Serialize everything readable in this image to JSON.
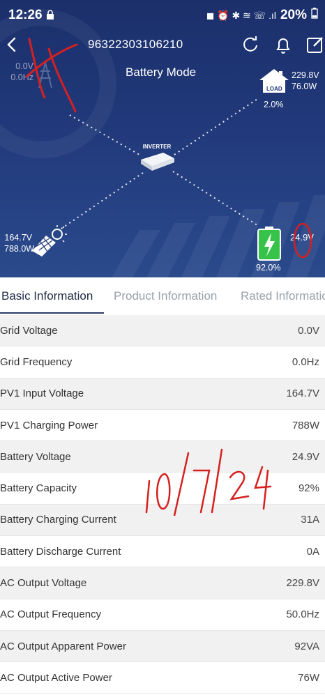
{
  "status_bar": {
    "time": "12:26",
    "battery_percent": "20%"
  },
  "header": {
    "device_id": "96322303106210",
    "mode": "Battery Mode"
  },
  "diagram": {
    "grid": {
      "voltage": "0.0V",
      "frequency": "0.0Hz"
    },
    "load": {
      "voltage": "229.8V",
      "power": "76.0W",
      "percent": "2.0%",
      "label": "LOAD"
    },
    "inverter": {
      "label": "INVERTER"
    },
    "pv": {
      "voltage": "164.7V",
      "power": "788.0W"
    },
    "battery": {
      "voltage": "24.9V",
      "percent": "92.0%"
    }
  },
  "tabs": [
    {
      "label": "Basic Information",
      "active": true
    },
    {
      "label": "Product Information",
      "active": false
    },
    {
      "label": "Rated Information",
      "active": false
    }
  ],
  "rows": [
    {
      "label": "Grid Voltage",
      "value": "0.0V"
    },
    {
      "label": "Grid Frequency",
      "value": "0.0Hz"
    },
    {
      "label": "PV1 Input Voltage",
      "value": "164.7V"
    },
    {
      "label": "PV1 Charging Power",
      "value": "788W"
    },
    {
      "label": "Battery Voltage",
      "value": "24.9V"
    },
    {
      "label": "Battery Capacity",
      "value": "92%"
    },
    {
      "label": "Battery Charging Current",
      "value": "31A"
    },
    {
      "label": "Battery Discharge Current",
      "value": "0A"
    },
    {
      "label": "AC Output Voltage",
      "value": "229.8V"
    },
    {
      "label": "AC Output Frequency",
      "value": "50.0Hz"
    },
    {
      "label": "AC Output Apparent Power",
      "value": "92VA"
    },
    {
      "label": "AC Output Active Power",
      "value": "76W"
    }
  ],
  "annotations": {
    "handwritten_date": "10/7/24"
  },
  "colors": {
    "header_bg": "#21397a",
    "accent": "#2c3c66",
    "battery_green": "#37c24a",
    "ink_red": "#d62020"
  }
}
